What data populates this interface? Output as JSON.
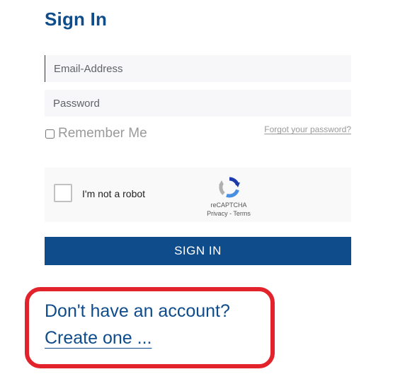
{
  "form": {
    "title": "Sign In",
    "email": {
      "value": "",
      "placeholder": "Email-Address"
    },
    "password": {
      "value": "",
      "placeholder": "Password"
    },
    "remember_label": "Remember Me",
    "remember_checked": false,
    "forgot_link": "Forgot your password?",
    "submit_label": "SIGN IN"
  },
  "recaptcha": {
    "label": "I'm not a robot",
    "brand": "reCAPTCHA",
    "privacy": "Privacy",
    "separator": " - ",
    "terms": "Terms",
    "checked": false,
    "logo_icon": "recaptcha-logo-icon"
  },
  "signup": {
    "prompt": "Don't have an account?",
    "link": "Create one ..."
  },
  "colors": {
    "brand_blue": "#0f4c8c",
    "highlight_red": "#e3232b"
  }
}
